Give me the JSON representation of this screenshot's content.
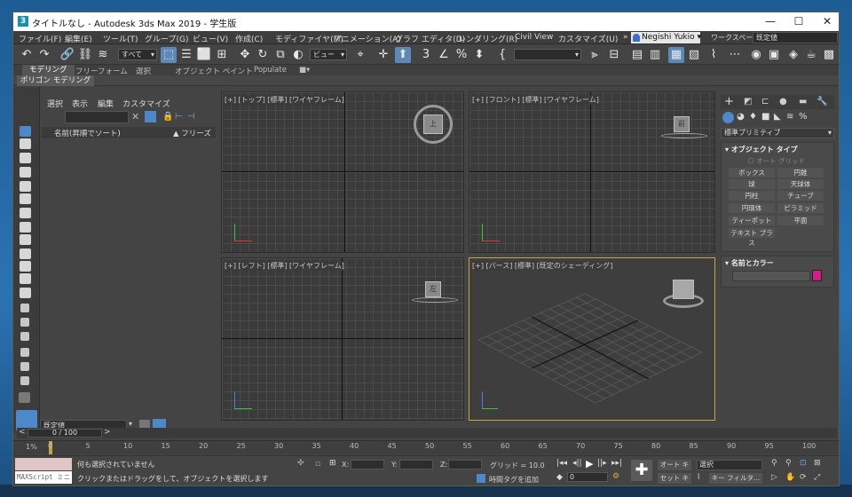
{
  "title": {
    "icon": "3",
    "text": "タイトルなし - Autodesk 3ds Max 2019 - 学生版"
  },
  "window_buttons": [
    {
      "icon": "minimize-icon",
      "glyph": "—"
    },
    {
      "icon": "maximize-icon",
      "glyph": "☐"
    },
    {
      "icon": "close-icon",
      "glyph": "✕"
    }
  ],
  "menu": [
    "ファイル(F)",
    "編集(E)",
    "ツール(T)",
    "グループ(G)",
    "ビュー(V)",
    "作成(C)",
    "モディファイヤ(M)",
    "アニメーション(A)",
    "グラフ エディタ(D)",
    "レンダリング(R)",
    "Civil View",
    "カスタマイズ(U)"
  ],
  "menu_more": "»",
  "user": "Negishi Yukio ▾",
  "workspace_label": "ワークスペース:",
  "workspace_value": "既定値",
  "toolbar": {
    "selection_filter": "すべて",
    "ref_coord": "ビュー",
    "named_set": ""
  },
  "ribbon": {
    "tabs": [
      "モデリング",
      "フリーフォーム",
      "選択",
      "オブジェクト ペイント",
      "Populate"
    ],
    "extra": "■▾",
    "active_sub": "ポリゴン モデリング"
  },
  "explorer": {
    "menu": [
      "選択",
      "表示",
      "編集",
      "カスタマイズ"
    ],
    "col_name": "名前(昇順でソート)",
    "col_freeze": "▲ フリーズ",
    "layer": "既定値"
  },
  "viewports": {
    "top": {
      "label": "[+] [トップ] [標準] [ワイヤフレーム]",
      "cube": "上"
    },
    "front": {
      "label": "[+] [フロント] [標準] [ワイヤフレーム]",
      "cube": "前"
    },
    "left": {
      "label": "[+] [レフト] [標準] [ワイヤフレーム]",
      "cube": "左"
    },
    "persp": {
      "label": "[+] [パース] [標準] [既定のシェーディング]",
      "cube": ""
    }
  },
  "cmd": {
    "category": "標準プリミティブ",
    "object_type_title": "オブジェクト タイプ",
    "autogrid": "オート グリッド",
    "buttons": [
      "ボックス",
      "円錐",
      "球",
      "天球体",
      "円柱",
      "チューブ",
      "円環体",
      "ピラミッド",
      "ティーポット",
      "平面",
      "テキスト プラス"
    ],
    "name_color_title": "名前とカラー",
    "color": "#d81b8a"
  },
  "time": {
    "frame": "0 / 100",
    "prev": "<",
    "next": ">",
    "percent": "1%",
    "ticks": [
      "0",
      "5",
      "10",
      "15",
      "20",
      "25",
      "30",
      "35",
      "40",
      "45",
      "50",
      "55",
      "60",
      "65",
      "70",
      "75",
      "80",
      "85",
      "90",
      "95",
      "100"
    ]
  },
  "status": {
    "maxscript": "MAXScript ミニ",
    "line1": "何も選択されていません",
    "line2": "クリックまたはドラッグをして、オブジェクトを選択します",
    "x_label": "X:",
    "y_label": "Y:",
    "z_label": "Z:",
    "grid": "グリッド = 10.0",
    "time_tag": "時間タグを追加",
    "frame_value": "0",
    "autokey": "オート キー",
    "setkey": "セット キー",
    "select_value": "選択",
    "key_filter": "キー フィルタ..."
  }
}
